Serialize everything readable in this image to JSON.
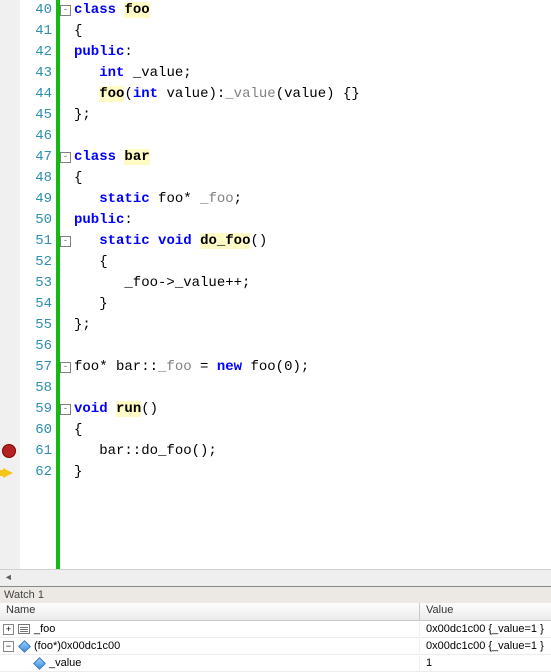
{
  "editor": {
    "line_start": 40,
    "lines": [
      {
        "n": 40,
        "fold": "-",
        "tokens": [
          {
            "t": "class ",
            "c": "kw"
          },
          {
            "t": "foo",
            "c": "id-hl"
          }
        ]
      },
      {
        "n": 41,
        "tokens": [
          {
            "t": "{",
            "c": "punct"
          }
        ]
      },
      {
        "n": 42,
        "tokens": [
          {
            "t": "public",
            "c": "kw"
          },
          {
            "t": ":",
            "c": "punct"
          }
        ]
      },
      {
        "n": 43,
        "tokens": [
          {
            "t": "   ",
            "c": "txt"
          },
          {
            "t": "int",
            "c": "kw"
          },
          {
            "t": " _value;",
            "c": "txt"
          }
        ]
      },
      {
        "n": 44,
        "tokens": [
          {
            "t": "   ",
            "c": "txt"
          },
          {
            "t": "foo",
            "c": "id-hl"
          },
          {
            "t": "(",
            "c": "punct"
          },
          {
            "t": "int",
            "c": "kw"
          },
          {
            "t": " value):",
            "c": "txt"
          },
          {
            "t": "_value",
            "c": "gray"
          },
          {
            "t": "(value) {}",
            "c": "txt"
          }
        ]
      },
      {
        "n": 45,
        "tokens": [
          {
            "t": "};",
            "c": "punct"
          }
        ]
      },
      {
        "n": 46,
        "tokens": [
          {
            "t": "",
            "c": "txt"
          }
        ]
      },
      {
        "n": 47,
        "fold": "-",
        "tokens": [
          {
            "t": "class ",
            "c": "kw"
          },
          {
            "t": "bar",
            "c": "id-hl"
          }
        ]
      },
      {
        "n": 48,
        "tokens": [
          {
            "t": "{",
            "c": "punct"
          }
        ]
      },
      {
        "n": 49,
        "tokens": [
          {
            "t": "   ",
            "c": "txt"
          },
          {
            "t": "static",
            "c": "kw"
          },
          {
            "t": " foo* ",
            "c": "txt"
          },
          {
            "t": "_foo",
            "c": "gray"
          },
          {
            "t": ";",
            "c": "punct"
          }
        ]
      },
      {
        "n": 50,
        "tokens": [
          {
            "t": "public",
            "c": "kw"
          },
          {
            "t": ":",
            "c": "punct"
          }
        ]
      },
      {
        "n": 51,
        "fold": "-",
        "tokens": [
          {
            "t": "   ",
            "c": "txt"
          },
          {
            "t": "static",
            "c": "kw"
          },
          {
            "t": " ",
            "c": "txt"
          },
          {
            "t": "void",
            "c": "kw"
          },
          {
            "t": " ",
            "c": "txt"
          },
          {
            "t": "do_foo",
            "c": "id-hl"
          },
          {
            "t": "()",
            "c": "punct"
          }
        ]
      },
      {
        "n": 52,
        "tokens": [
          {
            "t": "   {",
            "c": "punct"
          }
        ]
      },
      {
        "n": 53,
        "tokens": [
          {
            "t": "      _foo->_value++;",
            "c": "txt"
          }
        ]
      },
      {
        "n": 54,
        "tokens": [
          {
            "t": "   }",
            "c": "punct"
          }
        ]
      },
      {
        "n": 55,
        "tokens": [
          {
            "t": "};",
            "c": "punct"
          }
        ]
      },
      {
        "n": 56,
        "tokens": [
          {
            "t": "",
            "c": "txt"
          }
        ]
      },
      {
        "n": 57,
        "fold": "-",
        "tokens": [
          {
            "t": "foo* bar::",
            "c": "txt"
          },
          {
            "t": "_foo",
            "c": "gray"
          },
          {
            "t": " = ",
            "c": "txt"
          },
          {
            "t": "new",
            "c": "kw"
          },
          {
            "t": " foo(0);",
            "c": "txt"
          }
        ]
      },
      {
        "n": 58,
        "tokens": [
          {
            "t": "",
            "c": "txt"
          }
        ]
      },
      {
        "n": 59,
        "fold": "-",
        "tokens": [
          {
            "t": "void",
            "c": "kw"
          },
          {
            "t": " ",
            "c": "txt"
          },
          {
            "t": "run",
            "c": "id-hl"
          },
          {
            "t": "()",
            "c": "punct"
          }
        ]
      },
      {
        "n": 60,
        "tokens": [
          {
            "t": "{",
            "c": "punct"
          }
        ]
      },
      {
        "n": 61,
        "marker": "breakpoint",
        "tokens": [
          {
            "t": "   bar::do_foo();",
            "c": "txt"
          }
        ]
      },
      {
        "n": 62,
        "marker": "arrow",
        "tokens": [
          {
            "t": "}",
            "c": "punct"
          }
        ]
      }
    ]
  },
  "watch": {
    "title": "Watch 1",
    "columns": {
      "name": "Name",
      "value": "Value"
    },
    "rows": [
      {
        "expander": "+",
        "indent": 0,
        "icon": "struct",
        "name": "_foo",
        "value": "0x00dc1c00 {_value=1 }"
      },
      {
        "expander": "-",
        "indent": 0,
        "icon": "diamond",
        "name": "(foo*)0x00dc1c00",
        "value": "0x00dc1c00 {_value=1 }"
      },
      {
        "expander": "",
        "indent": 1,
        "icon": "diamond",
        "name": "_value",
        "value": "1"
      }
    ]
  }
}
